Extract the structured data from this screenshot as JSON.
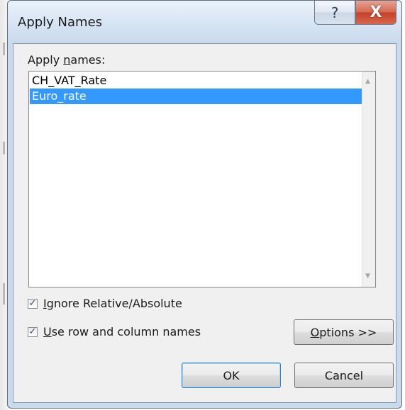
{
  "dialog": {
    "title": "Apply Names",
    "help_glyph": "?",
    "close_glyph": "X"
  },
  "list": {
    "label_prefix": "Apply ",
    "label_underlined": "n",
    "label_suffix": "ames:",
    "items": [
      {
        "text": "CH_VAT_Rate",
        "selected": false
      },
      {
        "text": "Euro_rate",
        "selected": true
      }
    ],
    "scroll_up": "▲",
    "scroll_down": "▼"
  },
  "options": {
    "ignore_relative": {
      "checked": true,
      "underlined": "I",
      "rest": "gnore Relative/Absolute"
    },
    "use_row_col": {
      "checked": true,
      "underlined": "U",
      "rest": "se row and column names"
    }
  },
  "buttons": {
    "options_underlined": "O",
    "options_rest": "ptions >>",
    "ok": "OK",
    "cancel": "Cancel"
  },
  "glyphs": {
    "check": "✓"
  },
  "colors": {
    "selection": "#3399ff",
    "window_frame": "#c9daed",
    "close": "#c4402a"
  }
}
